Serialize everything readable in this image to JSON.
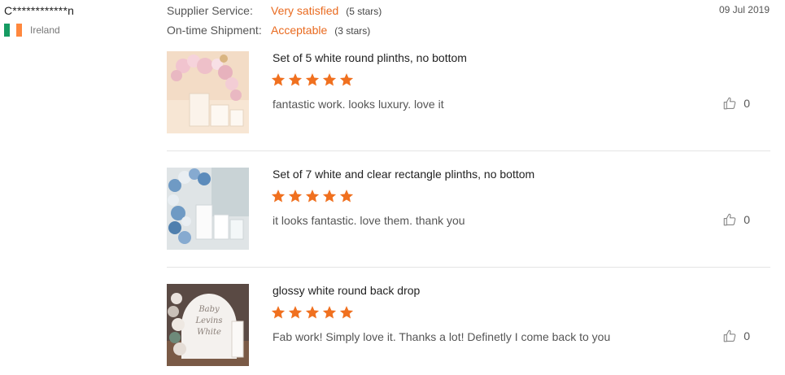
{
  "buyer": {
    "name": "C************n",
    "country": "Ireland"
  },
  "ratings": [
    {
      "label": "Supplier Service:",
      "value": "Very satisfied",
      "stars": "(5 stars)"
    },
    {
      "label": "On-time Shipment:",
      "value": "Acceptable",
      "stars": "(3 stars)"
    }
  ],
  "date": "09 Jul 2019",
  "colors": {
    "accent": "#e96a1f",
    "star": "#f0701f"
  },
  "reviews": [
    {
      "title": "Set of 5 white round plinths, no bottom",
      "rating": 5,
      "comment": "fantastic work. looks luxury. love it",
      "likes": "0",
      "icon": "thumbs-up-icon"
    },
    {
      "title": "Set of 7 white and clear rectangle plinths, no bottom",
      "rating": 5,
      "comment": "it looks fantastic. love them. thank you",
      "likes": "0",
      "icon": "thumbs-up-icon"
    },
    {
      "title": "glossy white round back drop",
      "rating": 5,
      "comment": "Fab work! Simply love it. Thanks a lot! Definetly I come back to you",
      "likes": "0",
      "icon": "thumbs-up-icon"
    }
  ]
}
